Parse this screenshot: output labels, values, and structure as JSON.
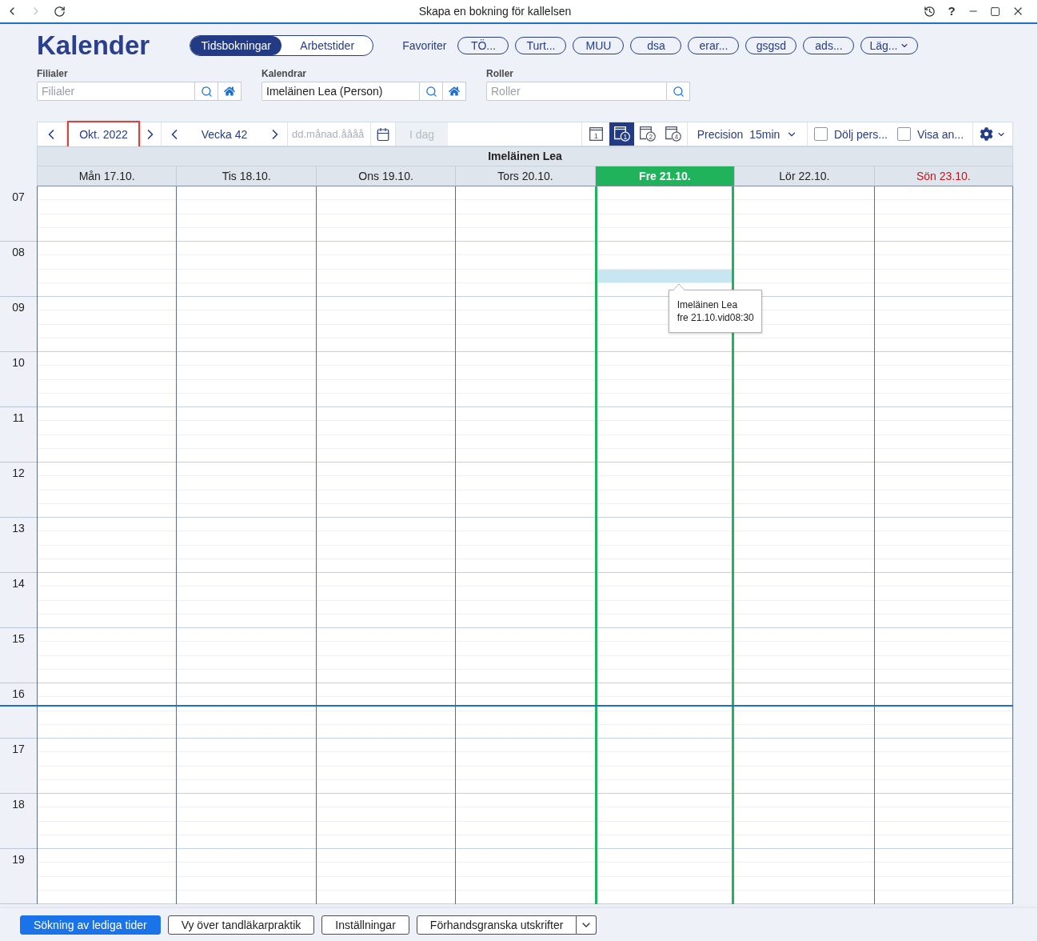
{
  "window": {
    "title": "Skapa en bokning för kallelsen",
    "help": "?",
    "back_disabled": false,
    "forward_disabled": true
  },
  "header": {
    "title": "Kalender",
    "modes": [
      {
        "label": "Tidsbokningar",
        "selected": true
      },
      {
        "label": "Arbetstider",
        "selected": false
      }
    ],
    "favorites_label": "Favoriter",
    "favorites": [
      {
        "label": "TÖ...",
        "kind": "chip"
      },
      {
        "label": "Turt...",
        "kind": "chip"
      },
      {
        "label": "MUU",
        "kind": "chip"
      },
      {
        "label": "dsa",
        "kind": "chip"
      },
      {
        "label": "erar...",
        "kind": "chip"
      },
      {
        "label": "gsgsd",
        "kind": "chip"
      },
      {
        "label": "ads...",
        "kind": "chip"
      },
      {
        "label": "Läg...",
        "kind": "menu"
      }
    ]
  },
  "filters": [
    {
      "label": "Filialer",
      "placeholder": "Filialer",
      "home_button": true
    },
    {
      "label": "Kalendrar",
      "value": "Imeläinen Lea (Person)",
      "home_button": true
    },
    {
      "label": "Roller",
      "placeholder": "Roller",
      "home_button": false
    }
  ],
  "toolbar": {
    "month": {
      "label": "Okt. 2022",
      "highlighted": true
    },
    "week": {
      "label": "Vecka 42"
    },
    "date_field": {
      "placeholder": "dd.månad.åååå"
    },
    "today_button": {
      "label": "I dag",
      "disabled": true
    },
    "views": [
      {
        "label": "1",
        "kind": "page",
        "selected": false
      },
      {
        "label": "1",
        "kind": "badge",
        "selected": true
      },
      {
        "label": "2",
        "kind": "badge",
        "selected": false
      },
      {
        "label": "4",
        "kind": "badge",
        "selected": false
      }
    ],
    "precision": {
      "label": "Precision",
      "value": "15min"
    },
    "checkboxes": [
      {
        "label": "Dölj pers...",
        "checked": false
      },
      {
        "label": "Visa an...",
        "checked": false
      }
    ]
  },
  "calendar": {
    "resource": "Imeläinen Lea",
    "days": [
      {
        "label": "Mån 17.10.",
        "today": false,
        "holiday": false,
        "hovered": false
      },
      {
        "label": "Tis 18.10.",
        "today": false,
        "holiday": false,
        "hovered": false
      },
      {
        "label": "Ons 19.10.",
        "today": false,
        "holiday": false,
        "hovered": false
      },
      {
        "label": "Tors 20.10.",
        "today": false,
        "holiday": false,
        "hovered": false
      },
      {
        "label": "Fre 21.10.",
        "today": true,
        "holiday": false,
        "hovered": true
      },
      {
        "label": "Lör 22.10.",
        "today": false,
        "holiday": false,
        "hovered": false
      },
      {
        "label": "Sön 23.10.",
        "today": false,
        "holiday": true,
        "hovered": false
      }
    ],
    "hours": [
      {
        "label": "07",
        "hovered_quarters": [
          false,
          false,
          false,
          false
        ],
        "now": false
      },
      {
        "label": "08",
        "hovered_quarters": [
          false,
          false,
          true,
          false
        ],
        "now": false
      },
      {
        "label": "09",
        "hovered_quarters": [
          false,
          false,
          false,
          false
        ],
        "now": false
      },
      {
        "label": "10",
        "hovered_quarters": [
          false,
          false,
          false,
          false
        ],
        "now": false
      },
      {
        "label": "11",
        "hovered_quarters": [
          false,
          false,
          false,
          false
        ],
        "now": false
      },
      {
        "label": "12",
        "hovered_quarters": [
          false,
          false,
          false,
          false
        ],
        "now": false
      },
      {
        "label": "13",
        "hovered_quarters": [
          false,
          false,
          false,
          false
        ],
        "now": false
      },
      {
        "label": "14",
        "hovered_quarters": [
          false,
          false,
          false,
          false
        ],
        "now": false
      },
      {
        "label": "15",
        "hovered_quarters": [
          false,
          false,
          false,
          false
        ],
        "now": false
      },
      {
        "label": "16",
        "hovered_quarters": [
          false,
          false,
          false,
          false
        ],
        "now": true
      },
      {
        "label": "17",
        "hovered_quarters": [
          false,
          false,
          false,
          false
        ],
        "now": false
      },
      {
        "label": "18",
        "hovered_quarters": [
          false,
          false,
          false,
          false
        ],
        "now": false
      },
      {
        "label": "19",
        "hovered_quarters": [
          false,
          false,
          false,
          false
        ],
        "now": false
      }
    ],
    "tooltip": {
      "lines": [
        "Imeläinen Lea",
        "fre 21.10.vid08:30"
      ]
    }
  },
  "footer": {
    "buttons": [
      {
        "label": "Sökning av lediga tider",
        "kind": "primary"
      },
      {
        "label": "Vy över tandläkarpraktik",
        "kind": "default"
      },
      {
        "label": "Inställningar",
        "kind": "default"
      },
      {
        "label": "Förhandsgranska utskrifter",
        "kind": "split"
      }
    ]
  }
}
